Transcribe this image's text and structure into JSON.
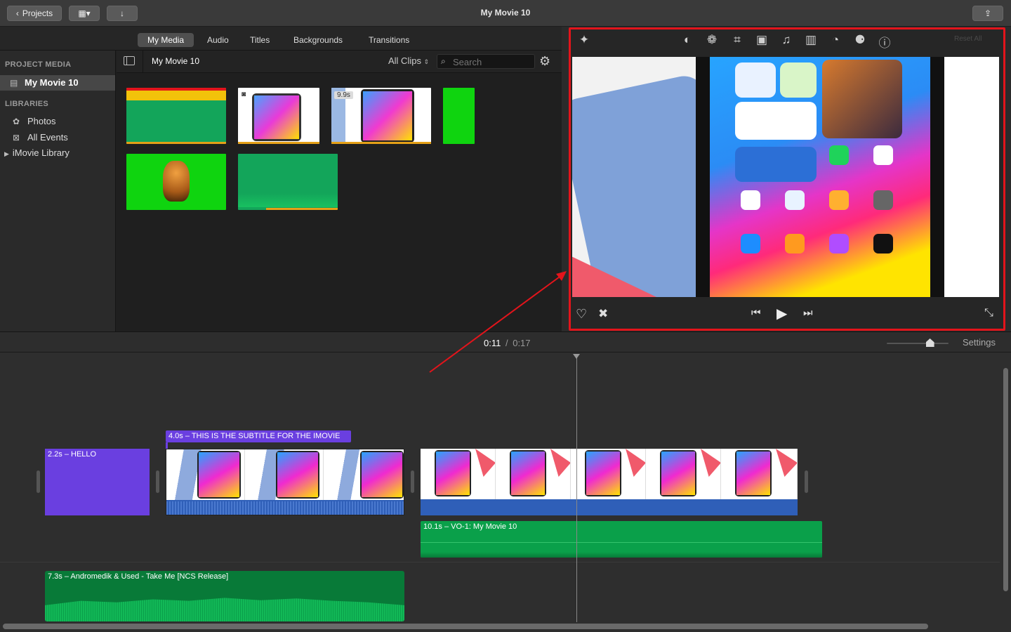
{
  "window": {
    "title": "My Movie 10"
  },
  "toolbar": {
    "projects_label": "Projects"
  },
  "browser_tabs": [
    {
      "label": "My Media"
    },
    {
      "label": "Audio"
    },
    {
      "label": "Titles"
    },
    {
      "label": "Backgrounds"
    },
    {
      "label": "Transitions"
    }
  ],
  "sidebar": {
    "project_media_heading": "PROJECT MEDIA",
    "project_item": "My Movie 10",
    "libraries_heading": "LIBRARIES",
    "library_items": [
      {
        "label": "Photos",
        "icon": "flower-icon"
      },
      {
        "label": "All Events",
        "icon": "star-box-icon"
      },
      {
        "label": "iMovie Library",
        "icon": "disclosure-triangle-icon"
      }
    ]
  },
  "media": {
    "header_title": "My Movie 10",
    "filter_label": "All Clips",
    "search_placeholder": "Search",
    "clip_duration_badge": "9.9s"
  },
  "viewer": {
    "reset_all_label": "Reset All"
  },
  "playhead": {
    "current": "0:11",
    "separator": "/",
    "total": "0:17"
  },
  "timeline": {
    "settings_label": "Settings",
    "zoom_level": 0.7,
    "clips": {
      "hello": "2.2s – HELLO",
      "subtitle": "4.0s – THIS IS THE SUBTITLE FOR THE IMOVIE",
      "voiceover": "10.1s – VO-1: My Movie 10",
      "music": "7.3s – Andromedik & Used - Take Me [NCS Release]"
    }
  },
  "colors": {
    "highlight_border": "#e3141b",
    "title_clip": "#6a3fe0",
    "audio_clip": "#0aa04a",
    "video_audio": "#2f5fb8"
  }
}
